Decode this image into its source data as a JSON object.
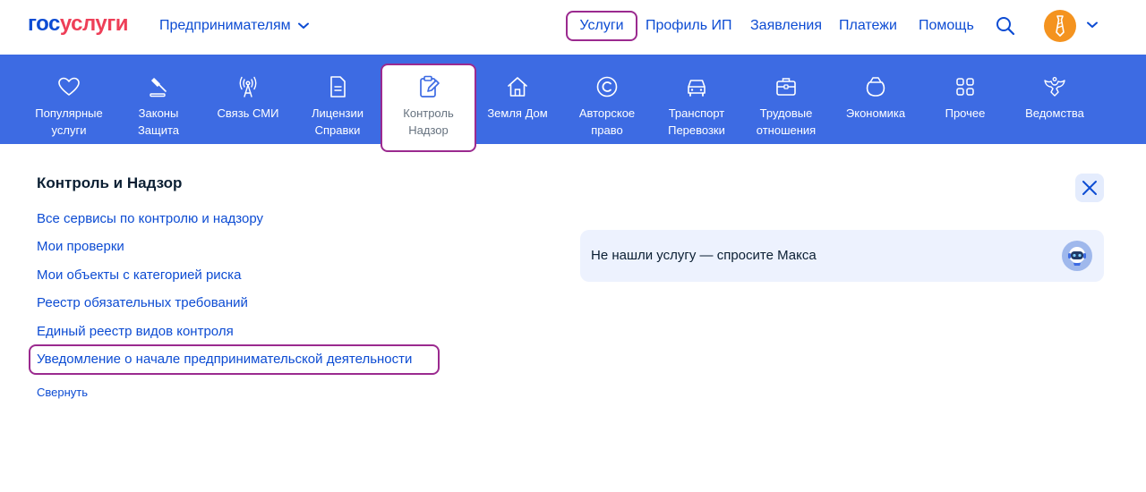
{
  "colors": {
    "brand_blue": "#0d4cd3",
    "brand_red": "#ee3f58",
    "category_bar": "#3d6be3",
    "highlight": "#9b2a8f",
    "avatar": "#f4931f"
  },
  "header": {
    "logo_part1": "гос",
    "logo_part2": "услуги",
    "audience": "Предпринимателям",
    "nav": [
      "Услуги",
      "Профиль ИП",
      "Заявления",
      "Платежи",
      "Помощь"
    ],
    "icons": [
      "search-icon",
      "avatar",
      "chevron-down-icon"
    ]
  },
  "categories": [
    {
      "label": "Популярные\nуслуги",
      "icon": "heart-icon"
    },
    {
      "label": "Законы\nЗащита",
      "icon": "gavel-icon"
    },
    {
      "label": "Связь СМИ",
      "icon": "antenna-icon"
    },
    {
      "label": "Лицензии\nСправки",
      "icon": "document-icon"
    },
    {
      "label": "Контроль\nНадзор",
      "icon": "clipboard-edit-icon",
      "active": true
    },
    {
      "label": "Земля Дом",
      "icon": "house-icon"
    },
    {
      "label": "Авторское\nправо",
      "icon": "copyright-icon"
    },
    {
      "label": "Транспорт\nПеревозки",
      "icon": "car-icon"
    },
    {
      "label": "Трудовые\nотношения",
      "icon": "briefcase-icon"
    },
    {
      "label": "Экономика",
      "icon": "wallet-icon"
    },
    {
      "label": "Прочее",
      "icon": "grid-icon"
    },
    {
      "label": "Ведомства",
      "icon": "eagle-icon"
    }
  ],
  "section": {
    "title": "Контроль и Надзор",
    "links": [
      "Все сервисы по контролю и надзору",
      "Мои проверки",
      "Мои объекты с категорией риска",
      "Реестр обязательных требований",
      "Единый реестр видов контроля",
      "Уведомление о начале предпринимательской деятельности"
    ],
    "collapse": "Свернуть"
  },
  "assistant": {
    "text": "Не нашли услугу — спросите Макса",
    "icon": "robot-avatar-icon"
  }
}
